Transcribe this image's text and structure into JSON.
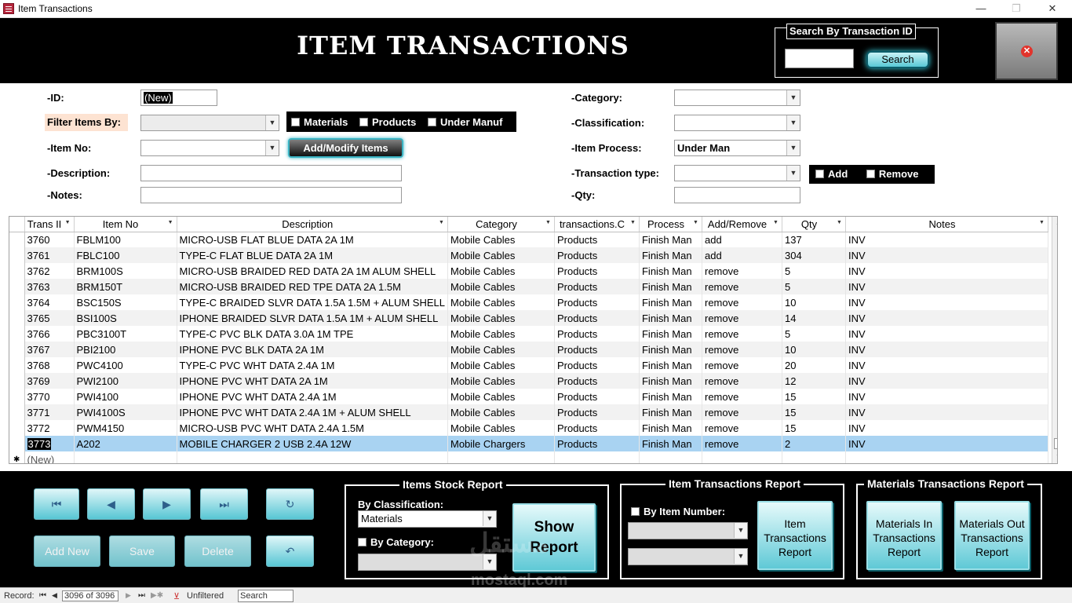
{
  "window": {
    "title": "Item Transactions",
    "minimize": "—",
    "restore": "❐",
    "close": "✕"
  },
  "header": {
    "title": "ITEM TRANSACTIONS",
    "search_legend": "Search By Transaction ID",
    "search_value": "",
    "search_button": "Search"
  },
  "form": {
    "id_label": "-ID:",
    "id_value": "(New)",
    "filter_label": "Filter Items By:",
    "filter_value": "",
    "filter_materials": "Materials",
    "filter_products": "Products",
    "filter_under_manuf": "Under Manuf",
    "item_no_label": "-Item No:",
    "item_no_value": "",
    "add_modify_button": "Add/Modify Items",
    "description_label": "-Description:",
    "description_value": "",
    "notes_label": "-Notes:",
    "notes_value": "",
    "category_label": "-Category:",
    "category_value": "",
    "classification_label": "-Classification:",
    "classification_value": "",
    "item_process_label": "-Item Process:",
    "item_process_value": "Under Man",
    "transaction_type_label": "-Transaction type:",
    "transaction_type_value": "",
    "add_label": "Add",
    "remove_label": "Remove",
    "qty_label": "-Qty:",
    "qty_value": ""
  },
  "grid": {
    "columns": [
      "Trans II",
      "Item No",
      "Description",
      "Category",
      "transactions.C",
      "Process",
      "Add/Remove",
      "Qty",
      "Notes"
    ],
    "rows": [
      [
        "3760",
        "FBLM100",
        "MICRO-USB FLAT BLUE DATA 2A 1M",
        "Mobile Cables",
        "Products",
        "Finish Man",
        "add",
        "137",
        "INV"
      ],
      [
        "3761",
        "FBLC100",
        "TYPE-C FLAT BLUE DATA 2A 1M",
        "Mobile Cables",
        "Products",
        "Finish Man",
        "add",
        "304",
        "INV"
      ],
      [
        "3762",
        "BRM100S",
        "MICRO-USB BRAIDED RED DATA 2A 1M ALUM SHELL",
        "Mobile Cables",
        "Products",
        "Finish Man",
        "remove",
        "5",
        "INV"
      ],
      [
        "3763",
        "BRM150T",
        "MICRO-USB BRAIDED RED TPE DATA 2A 1.5M",
        "Mobile Cables",
        "Products",
        "Finish Man",
        "remove",
        "5",
        "INV"
      ],
      [
        "3764",
        "BSC150S",
        "TYPE-C BRAIDED SLVR DATA 1.5A 1.5M + ALUM SHELL",
        "Mobile Cables",
        "Products",
        "Finish Man",
        "remove",
        "10",
        "INV"
      ],
      [
        "3765",
        "BSI100S",
        "IPHONE BRAIDED SLVR DATA 1.5A 1M + ALUM SHELL",
        "Mobile Cables",
        "Products",
        "Finish Man",
        "remove",
        "14",
        "INV"
      ],
      [
        "3766",
        "PBC3100T",
        "TYPE-C PVC BLK DATA 3.0A 1M TPE",
        "Mobile Cables",
        "Products",
        "Finish Man",
        "remove",
        "5",
        "INV"
      ],
      [
        "3767",
        "PBI2100",
        "IPHONE PVC BLK DATA 2A 1M",
        "Mobile Cables",
        "Products",
        "Finish Man",
        "remove",
        "10",
        "INV"
      ],
      [
        "3768",
        "PWC4100",
        "TYPE-C PVC WHT DATA 2.4A 1M",
        "Mobile Cables",
        "Products",
        "Finish Man",
        "remove",
        "20",
        "INV"
      ],
      [
        "3769",
        "PWI2100",
        "IPHONE PVC WHT DATA 2A 1M",
        "Mobile Cables",
        "Products",
        "Finish Man",
        "remove",
        "12",
        "INV"
      ],
      [
        "3770",
        "PWI4100",
        "IPHONE PVC WHT DATA 2.4A 1M",
        "Mobile Cables",
        "Products",
        "Finish Man",
        "remove",
        "15",
        "INV"
      ],
      [
        "3771",
        "PWI4100S",
        "IPHONE PVC WHT DATA 2.4A 1M + ALUM SHELL",
        "Mobile Cables",
        "Products",
        "Finish Man",
        "remove",
        "15",
        "INV"
      ],
      [
        "3772",
        "PWM4150",
        "MICRO-USB PVC WHT DATA 2.4A 1.5M",
        "Mobile Cables",
        "Products",
        "Finish Man",
        "remove",
        "15",
        "INV"
      ],
      [
        "3773",
        "A202",
        "MOBILE CHARGER 2 USB 2.4A 12W",
        "Mobile Chargers",
        "Products",
        "Finish Man",
        "remove",
        "2",
        "INV"
      ]
    ],
    "selected_row": 13,
    "new_row_label": "(New)",
    "new_row_marker": "✱"
  },
  "nav": {
    "first_icon": "⏮",
    "prev_icon": "◀",
    "next_icon": "▶",
    "last_icon": "⏭",
    "export_icon": "↻",
    "add_new": "Add New",
    "save": "Save",
    "delete": "Delete",
    "undo_icon": "↶"
  },
  "stock_report": {
    "title": "Items Stock Report",
    "by_classification_label": "By Classification:",
    "classification_value": "Materials",
    "by_category_label": "By Category:",
    "category_value": "",
    "show_report_line1": "Show",
    "show_report_line2": "Report"
  },
  "transactions_report": {
    "title": "Item Transactions Report",
    "by_item_number_label": "By Item Number:",
    "button_line1": "Item",
    "button_line2": "Transactions",
    "button_line3": "Report"
  },
  "materials_report": {
    "title": "Materials Transactions Report",
    "in_line1": "Materials In",
    "in_line2": "Transactions",
    "in_line3": "Report",
    "out_line1": "Materials Out",
    "out_line2": "Transactions",
    "out_line3": "Report"
  },
  "watermark": {
    "logo": "مستقل",
    "text": "mostaql.com"
  },
  "statusbar": {
    "record_label": "Record:",
    "record_value": "3096 of 3096",
    "filter_status": "Unfiltered",
    "search_placeholder": "Search"
  },
  "colors": {
    "accent_cyan": "#57c6d4",
    "selected_row": "#a9d3f2",
    "header_bg": "#000000"
  }
}
